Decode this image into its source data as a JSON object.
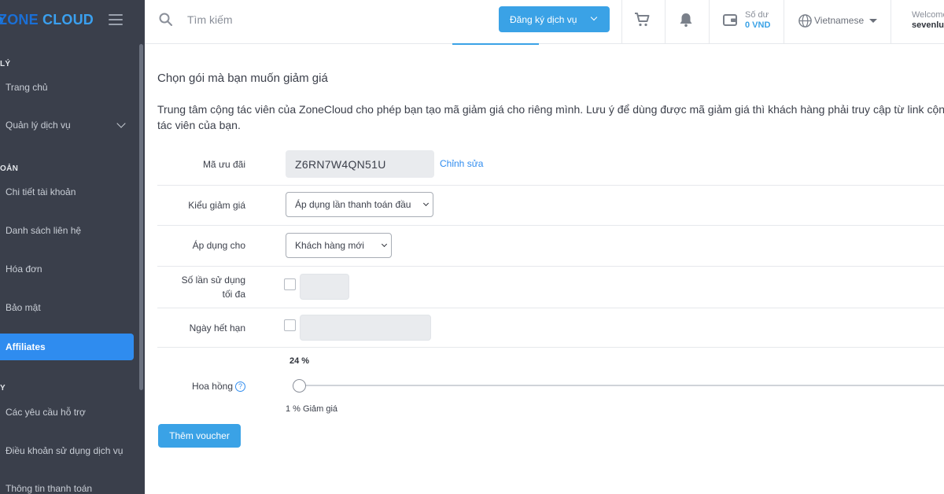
{
  "brand": {
    "part1": "ZONE",
    "part2": "CLOUD"
  },
  "sidebar": {
    "sections": [
      "LÝ",
      "OẢN",
      "Y"
    ],
    "items": [
      {
        "label": "Trang chủ"
      },
      {
        "label": "Quản lý dịch vụ"
      },
      {
        "label": "Chi tiết tài khoản"
      },
      {
        "label": "Danh sách liên hệ"
      },
      {
        "label": "Hóa đơn"
      },
      {
        "label": "Bảo mật"
      },
      {
        "label": "Affiliates"
      },
      {
        "label": "Các yêu cầu hỗ trợ"
      },
      {
        "label": "Điều khoản sử dụng dịch vụ"
      },
      {
        "label": "Thông tin thanh toán"
      }
    ]
  },
  "topbar": {
    "search_placeholder": "Tìm kiếm",
    "register_label": "Đăng ký dịch vụ",
    "balance_label": "Số dư",
    "balance_value": "0 VND",
    "language": "Vietnamese",
    "welcome_label": "Welcome",
    "username": "sevenlu"
  },
  "main": {
    "title": "Chọn gói mà bạn muốn giảm giá",
    "description": "Trung tâm cộng tác viên của ZoneCloud cho phép bạn tạo mã giảm giá cho riêng mình. Lưu ý để dùng được mã giảm giá thì khách hàng phải truy cập từ link cộng tác viên của bạn.",
    "form": {
      "code_label": "Mã ưu đãi",
      "code_value": "Z6RN7W4QN51U",
      "edit_label": "Chỉnh sửa",
      "discount_type_label": "Kiểu giảm giá",
      "discount_type_value": "Áp dụng lần thanh toán đầu",
      "apply_for_label": "Áp dụng cho",
      "apply_for_value": "Khách hàng mới",
      "max_uses_label_line1": "Số lần sử dụng",
      "max_uses_label_line2": "tối đa",
      "expiry_label": "Ngày hết hạn",
      "commission_label": "Hoa hồng",
      "commission_value": "24 %",
      "discount_caption": "1 % Giảm giá",
      "help_glyph": "?"
    },
    "add_button": "Thêm voucher"
  },
  "colors": {
    "accent": "#3aa2e6",
    "sidebar_bg": "#3a3f4b",
    "active": "#2f8cef"
  }
}
